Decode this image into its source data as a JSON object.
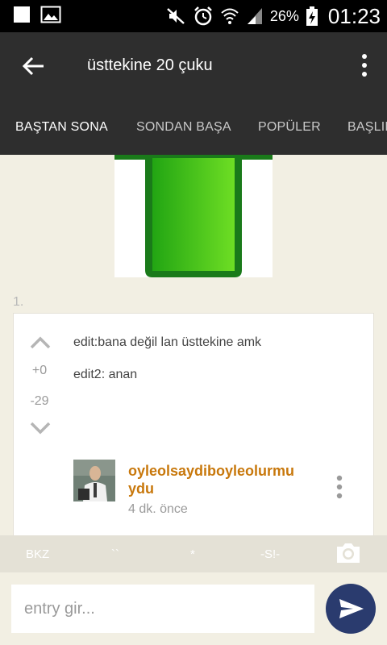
{
  "status_bar": {
    "battery_percent": "26%",
    "time": "01:23",
    "icons": [
      "stop-icon",
      "gallery-icon",
      "mute-icon",
      "alarm-icon",
      "wifi-icon",
      "signal-icon",
      "battery-charging-icon"
    ]
  },
  "toolbar": {
    "title": "üsttekine 20 çuku"
  },
  "tabs": [
    {
      "label": "BAŞTAN SONA",
      "active": true
    },
    {
      "label": "SONDAN BAŞA",
      "active": false
    },
    {
      "label": "POPÜLER",
      "active": false
    },
    {
      "label": "BAŞLIK",
      "active": false
    }
  ],
  "entry": {
    "number": "1.",
    "plus": "+0",
    "minus": "-29",
    "lines": [
      "edit:bana değil lan üsttekine amk",
      "edit2: anan"
    ],
    "author": "oyleolsaydiboyleolurmuydu",
    "time_ago": "4 dk. önce"
  },
  "format_bar": {
    "bkz": "BKZ",
    "backtick": "``",
    "star": "*",
    "spoiler": "-S!-"
  },
  "input": {
    "placeholder": "entry gir..."
  },
  "colors": {
    "toolbar": "#2e2e2e",
    "background": "#f2efe3",
    "author": "#c8780c",
    "send_button": "#2a3b6e",
    "image_green": "#3cc21a"
  }
}
